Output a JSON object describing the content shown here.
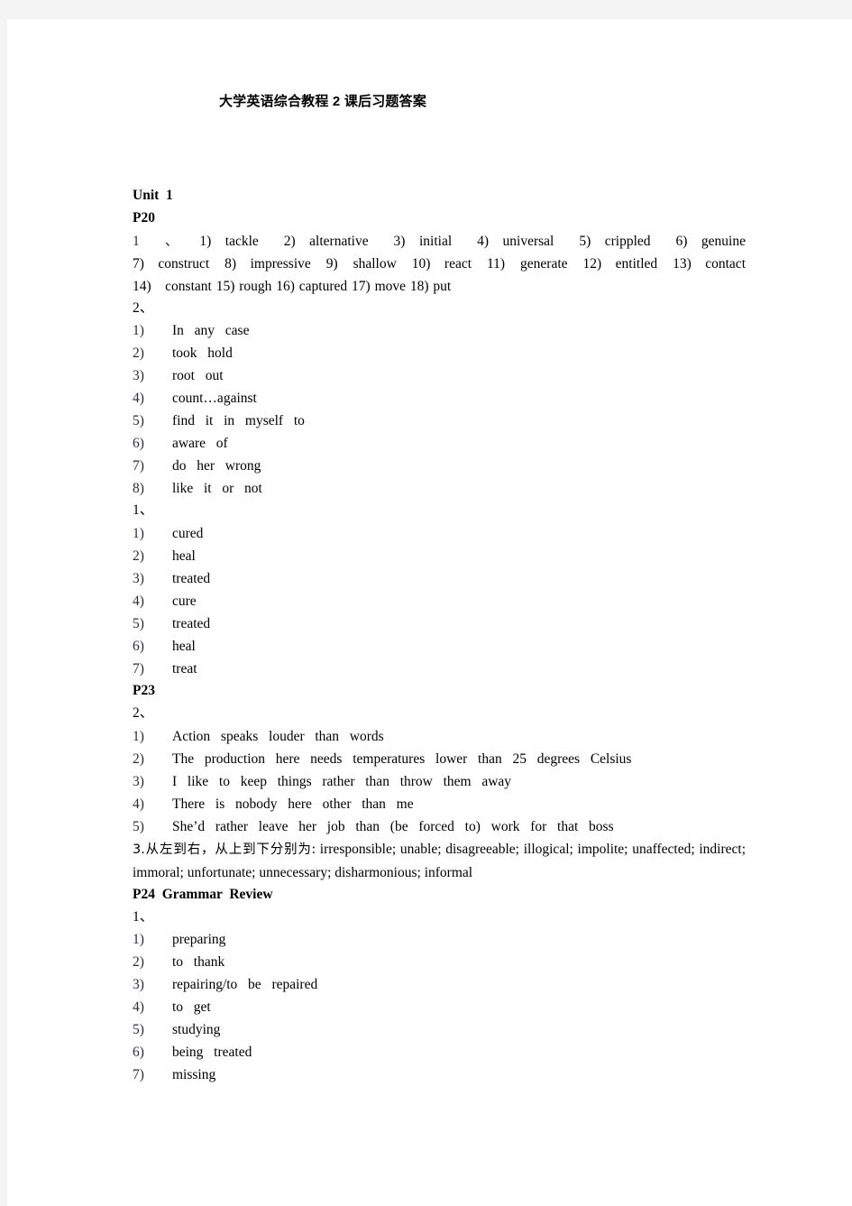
{
  "document": {
    "title": "大学英语综合教程 2 课后习题答案",
    "page_background": "#ffffff",
    "canvas_background": "#f4f4f4",
    "text_color": "#000000"
  },
  "unit": {
    "heading": "Unit  1"
  },
  "p20": {
    "heading": "P20",
    "section1_label": "1 、",
    "section1_line1": "1) tackle  2) alternative  3) initial  4) universal  5) crippled  6) genuine",
    "section1_line2": "7) construct 8) impressive  9)  shallow 10) react 11) generate 12) entitled 13) contact",
    "section1_line3": "14) constant  15)  rough 16)  captured 17)  move 18)  put",
    "section2_label": "2、",
    "section2_items": [
      {
        "num": "1)",
        "text": "In  any  case"
      },
      {
        "num": "2)",
        "text": "took  hold"
      },
      {
        "num": "3)",
        "text": "root  out"
      },
      {
        "num": "4)",
        "text": "count…against"
      },
      {
        "num": "5)",
        "text": "find  it  in  myself  to"
      },
      {
        "num": "6)",
        "text": "aware  of"
      },
      {
        "num": "7)",
        "text": "do  her  wrong"
      },
      {
        "num": "8)",
        "text": "like  it  or  not"
      }
    ],
    "section3_label": "1、",
    "section3_items": [
      {
        "num": "1)",
        "text": "cured"
      },
      {
        "num": "2)",
        "text": "heal"
      },
      {
        "num": "3)",
        "text": "treated"
      },
      {
        "num": "4)",
        "text": "cure"
      },
      {
        "num": "5)",
        "text": "treated"
      },
      {
        "num": "6)",
        "text": "heal"
      },
      {
        "num": "7)",
        "text": "treat"
      }
    ]
  },
  "p23": {
    "heading": "P23",
    "section2_label": "2、",
    "section2_items": [
      {
        "num": "1)",
        "text": "Action  speaks  louder  than  words"
      },
      {
        "num": "2)",
        "text": "The  production  here  needs  temperatures  lower  than  25  degrees  Celsius"
      },
      {
        "num": "3)",
        "text": "I  like  to  keep  things  rather  than  throw  them  away"
      },
      {
        "num": "4)",
        "text": "There  is  nobody  here  other  than  me"
      },
      {
        "num": "5)",
        "text": "She’d  rather  leave  her  job  than  (be  forced  to)  work  for  that  boss"
      }
    ],
    "section3_prefix_cn": "3.从左到右，从上到下分别为",
    "section3_text": ": irresponsible; unable; disagreeable; illogical; impolite; unaffected; indirect; immoral; unfortunate; unnecessary; disharmonious; informal"
  },
  "p24": {
    "heading": "P24  Grammar  Review",
    "section1_label": "1、",
    "section1_items": [
      {
        "num": "1)",
        "text": "preparing"
      },
      {
        "num": "2)",
        "text": "to  thank"
      },
      {
        "num": "3)",
        "text": "repairing/to  be  repaired"
      },
      {
        "num": "4)",
        "text": "to  get"
      },
      {
        "num": "5)",
        "text": "studying"
      },
      {
        "num": "6)",
        "text": "being  treated"
      },
      {
        "num": "7)",
        "text": "missing"
      }
    ]
  }
}
